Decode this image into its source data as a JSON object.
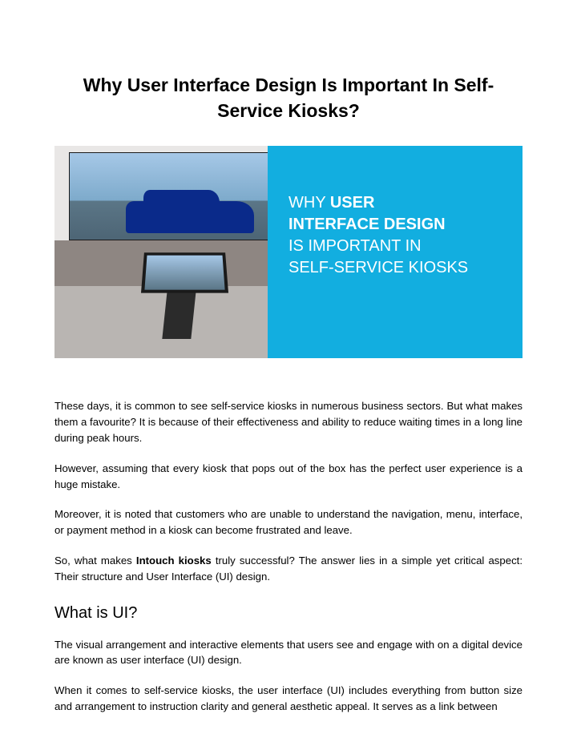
{
  "title": "Why User Interface Design Is Important In Self-Service Kiosks?",
  "hero": {
    "line1_prefix": "WHY ",
    "line1_bold": "USER",
    "line2_bold": "INTERFACE DESIGN",
    "line3": "IS IMPORTANT IN",
    "line4": "SELF-SERVICE KIOSKS"
  },
  "paragraphs": {
    "p1": "These days, it is common to see self-service kiosks in numerous business sectors. But what makes them a favourite? It is because of their effectiveness and ability to reduce waiting times in a long line during peak hours.",
    "p2": "However, assuming that every kiosk that pops out of the box has the perfect user experience is a huge mistake.",
    "p3": "Moreover, it is noted that customers who are unable to understand the navigation, menu, interface, or payment method in a kiosk can become frustrated and leave.",
    "p4_a": "So, what makes ",
    "p4_bold": "Intouch kiosks",
    "p4_b": " truly successful? The answer lies in a simple yet critical aspect: Their structure and User Interface (UI) design."
  },
  "section_heading": "What is UI?",
  "paragraphs2": {
    "p5": "The visual arrangement and interactive elements that users see and engage with on a digital device are known as user interface (UI) design.",
    "p6": "When it comes to self-service kiosks, the user interface (UI) includes everything from button size and arrangement to instruction clarity and general aesthetic appeal. It serves as a link between"
  }
}
